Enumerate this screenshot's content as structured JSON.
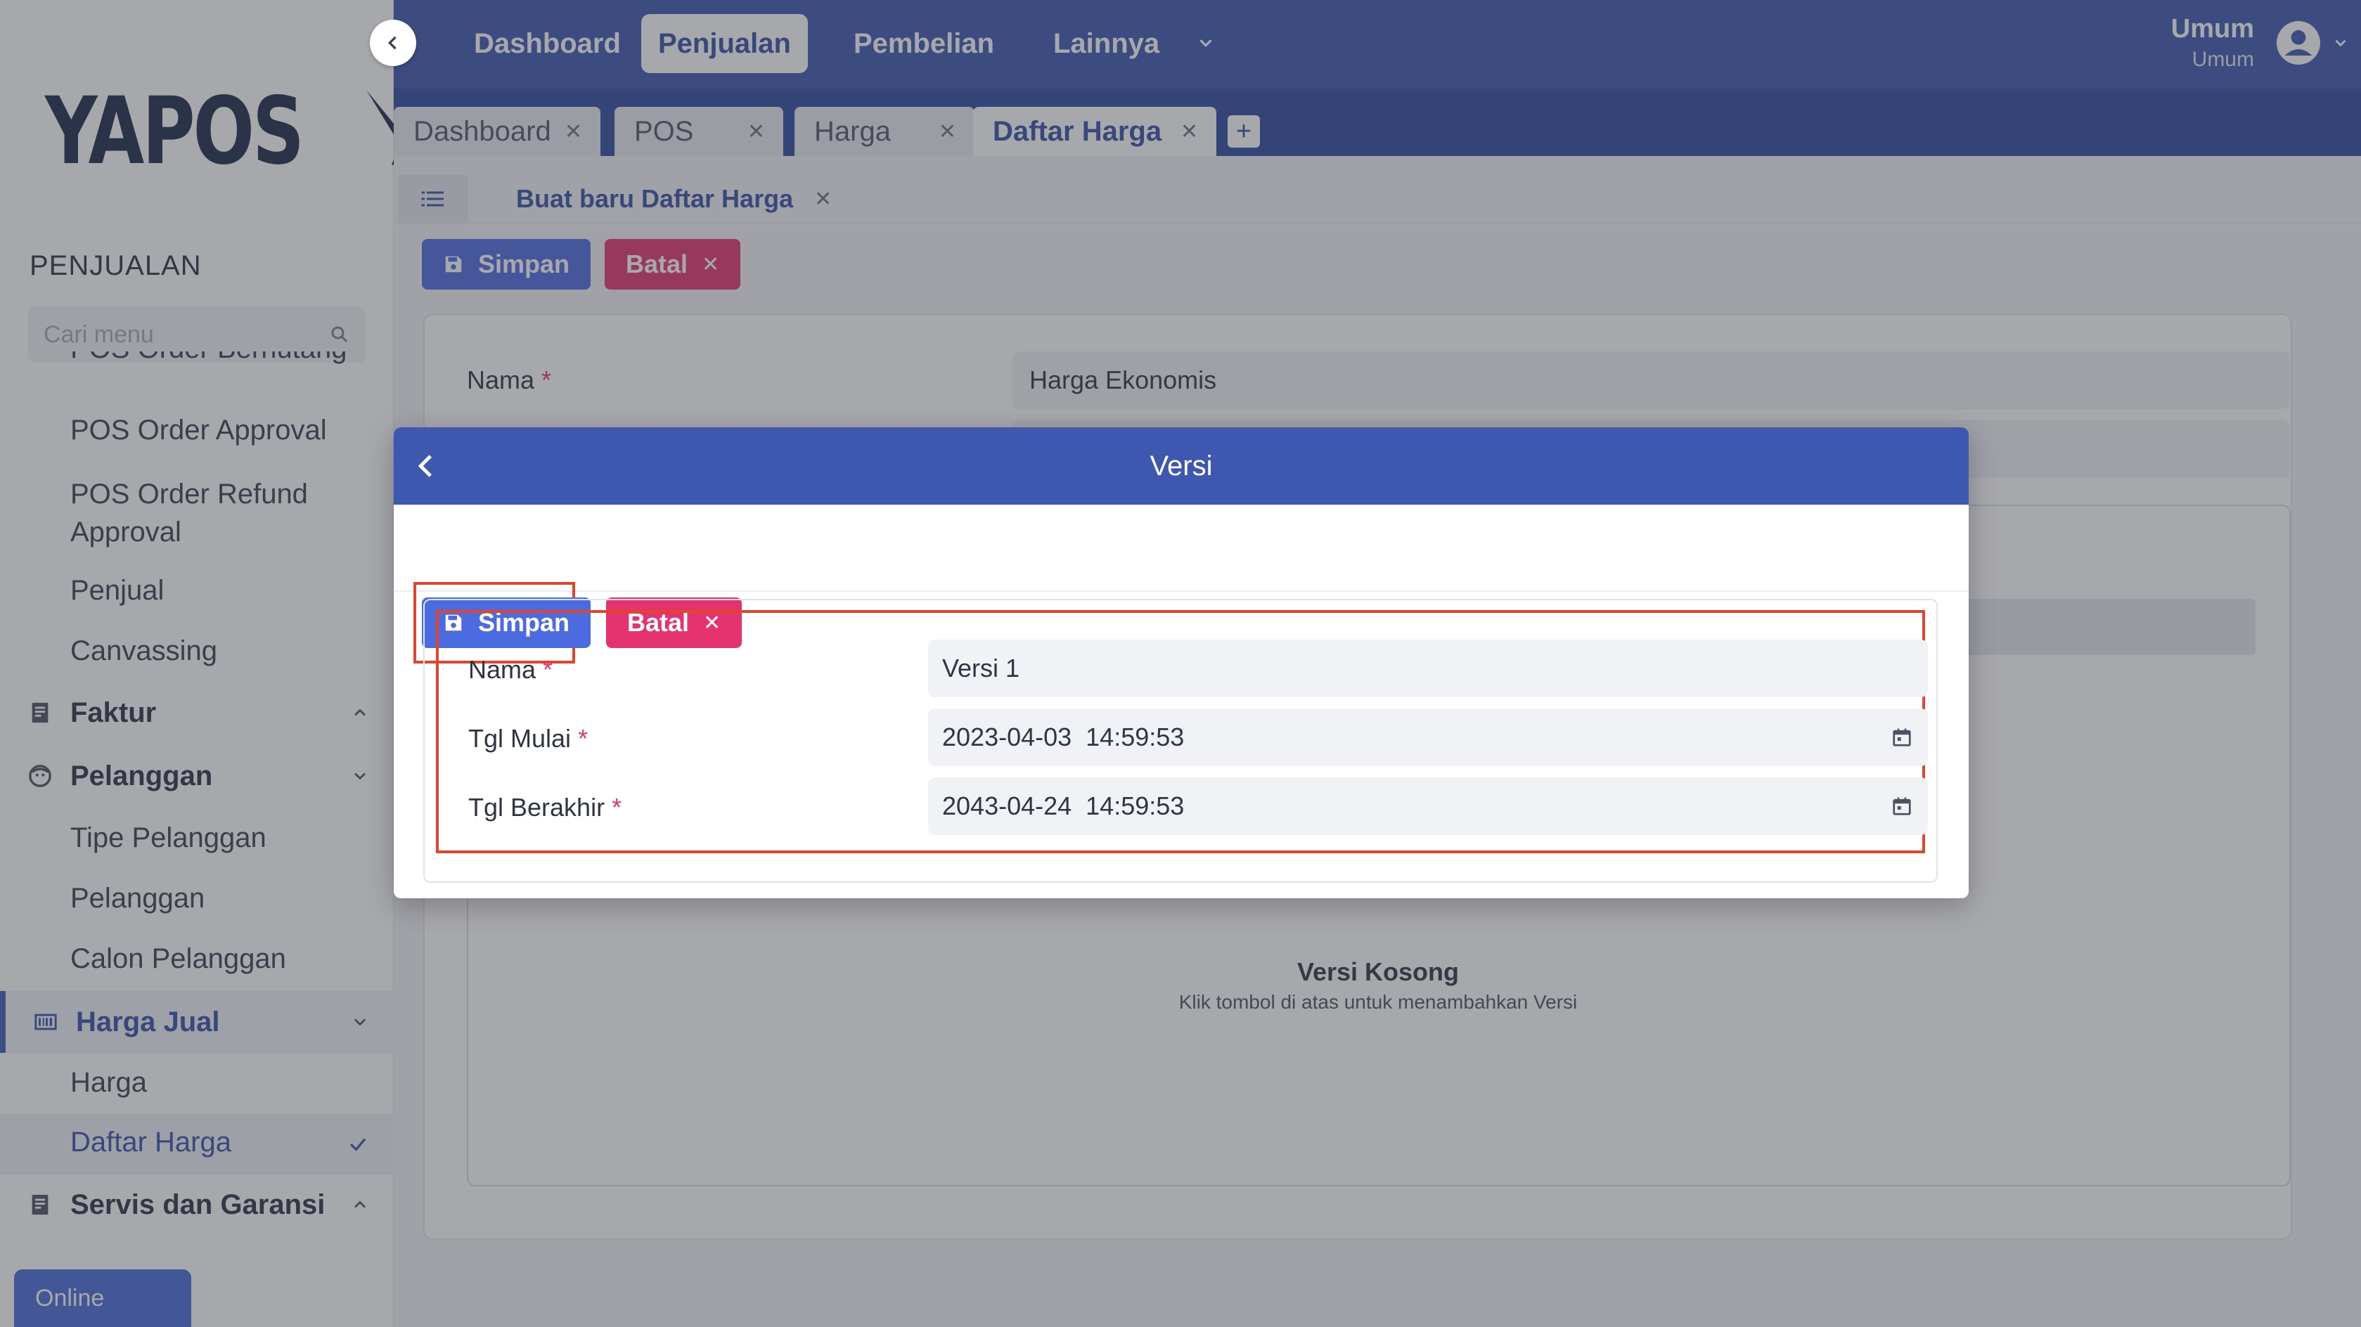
{
  "brand": {
    "logo_text": "YAPOS"
  },
  "sidebar": {
    "section_title": "PENJUALAN",
    "search_placeholder": "Cari menu",
    "items": [
      {
        "label": "POS Order Berhutang"
      },
      {
        "label": "POS Order Approval"
      },
      {
        "label": "POS Order Refund Approval"
      },
      {
        "label": "Penjual"
      },
      {
        "label": "Canvassing"
      }
    ],
    "groups": {
      "faktur": "Faktur",
      "pelanggan": "Pelanggan",
      "harga_jual": "Harga Jual",
      "servis": "Servis dan Garansi"
    },
    "pelanggan_items": [
      "Tipe Pelanggan",
      "Pelanggan",
      "Calon Pelanggan"
    ],
    "harga_items": [
      "Harga",
      "Daftar Harga"
    ],
    "status": "Online"
  },
  "topnav": {
    "items": [
      "Dashboard",
      "Penjualan",
      "Pembelian",
      "Lainnya"
    ],
    "active": "Penjualan",
    "user_name": "Umum",
    "user_role": "Umum"
  },
  "tabs": [
    {
      "label": "Dashboard"
    },
    {
      "label": "POS"
    },
    {
      "label": "Harga"
    },
    {
      "label": "Daftar Harga",
      "active": true
    }
  ],
  "subtab": {
    "label": "Buat baru Daftar Harga"
  },
  "toolbar": {
    "save_label": "Simpan",
    "cancel_label": "Batal"
  },
  "form": {
    "nama_label": "Nama",
    "nama_value": "Harga Ekonomis",
    "empty_title": "Versi Kosong",
    "empty_sub": "Klik tombol di atas untuk menambahkan Versi"
  },
  "modal": {
    "title": "Versi",
    "save_label": "Simpan",
    "cancel_label": "Batal",
    "fields": {
      "nama_label": "Nama",
      "nama_value": "Versi 1",
      "mulai_label": "Tgl Mulai",
      "mulai_value": "2023-04-03  14:59:53",
      "akhir_label": "Tgl Berakhir",
      "akhir_value": "2043-04-24  14:59:53",
      "required_mark": "*"
    }
  },
  "colors": {
    "primary": "#3e58b0",
    "save": "#4d6be0",
    "cancel": "#e5336f",
    "highlight": "#e2452e"
  }
}
